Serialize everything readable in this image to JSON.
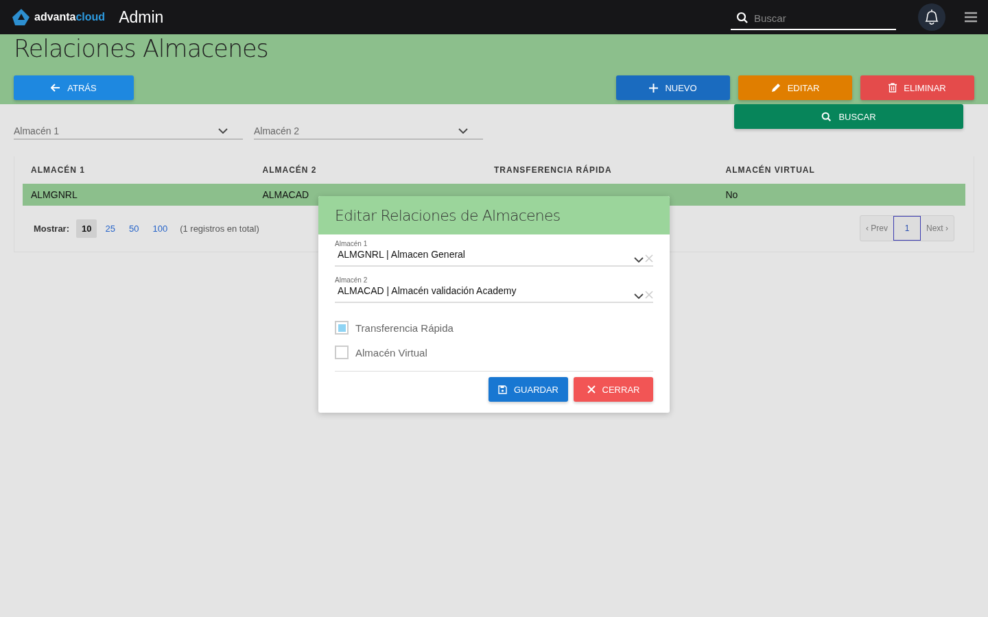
{
  "topbar": {
    "brand_a": "advanta",
    "brand_b": "cloud",
    "title": "Admin",
    "search": {
      "placeholder": "Buscar"
    }
  },
  "page": {
    "title": "Relaciones Almacenes",
    "back_button": "ATRÁS",
    "actions": [
      {
        "kind": "new",
        "label": "NUEVO"
      },
      {
        "kind": "edit",
        "label": "EDITAR"
      },
      {
        "kind": "delete",
        "label": "ELIMINAR"
      }
    ],
    "search_button": "BUSCAR"
  },
  "filters": [
    {
      "placeholder": "Almacén 1"
    },
    {
      "placeholder": "Almacén 2"
    }
  ],
  "table": {
    "columns": [
      "ALMACÉN 1",
      "ALMACÉN 2",
      "TRANSFERENCIA RÁPIDA",
      "ALMACÉN VIRTUAL"
    ],
    "rows": [
      {
        "selected": true,
        "almacen_1": "ALMGNRL",
        "almacen_2": "ALMACAD",
        "almacen_virtual": "No"
      }
    ]
  },
  "footer": {
    "show_label": "Mostrar:",
    "page_sizes": [
      {
        "label": "10",
        "selected": true
      },
      {
        "label": "25",
        "selected": false
      },
      {
        "label": "50",
        "selected": false
      },
      {
        "label": "100",
        "selected": false
      }
    ],
    "total": "(1 registros en total)",
    "prev": "‹ Prev",
    "pages": [
      {
        "label": "1",
        "selected": true
      }
    ],
    "next": "Next ›"
  },
  "dialog": {
    "title": "Editar Relaciones de Almacenes",
    "fields": [
      {
        "label": "Almacén 1",
        "value": "ALMGNRL | Almacen General"
      },
      {
        "label": "Almacén 2",
        "value": "ALMACAD | Almacén validación Academy"
      }
    ],
    "checkboxes": [
      {
        "label": "Transferencia Rápida",
        "checked": true
      },
      {
        "label": "Almacén Virtual",
        "checked": false
      }
    ],
    "save_button": "GUARDAR",
    "close_button": "CERRAR"
  }
}
